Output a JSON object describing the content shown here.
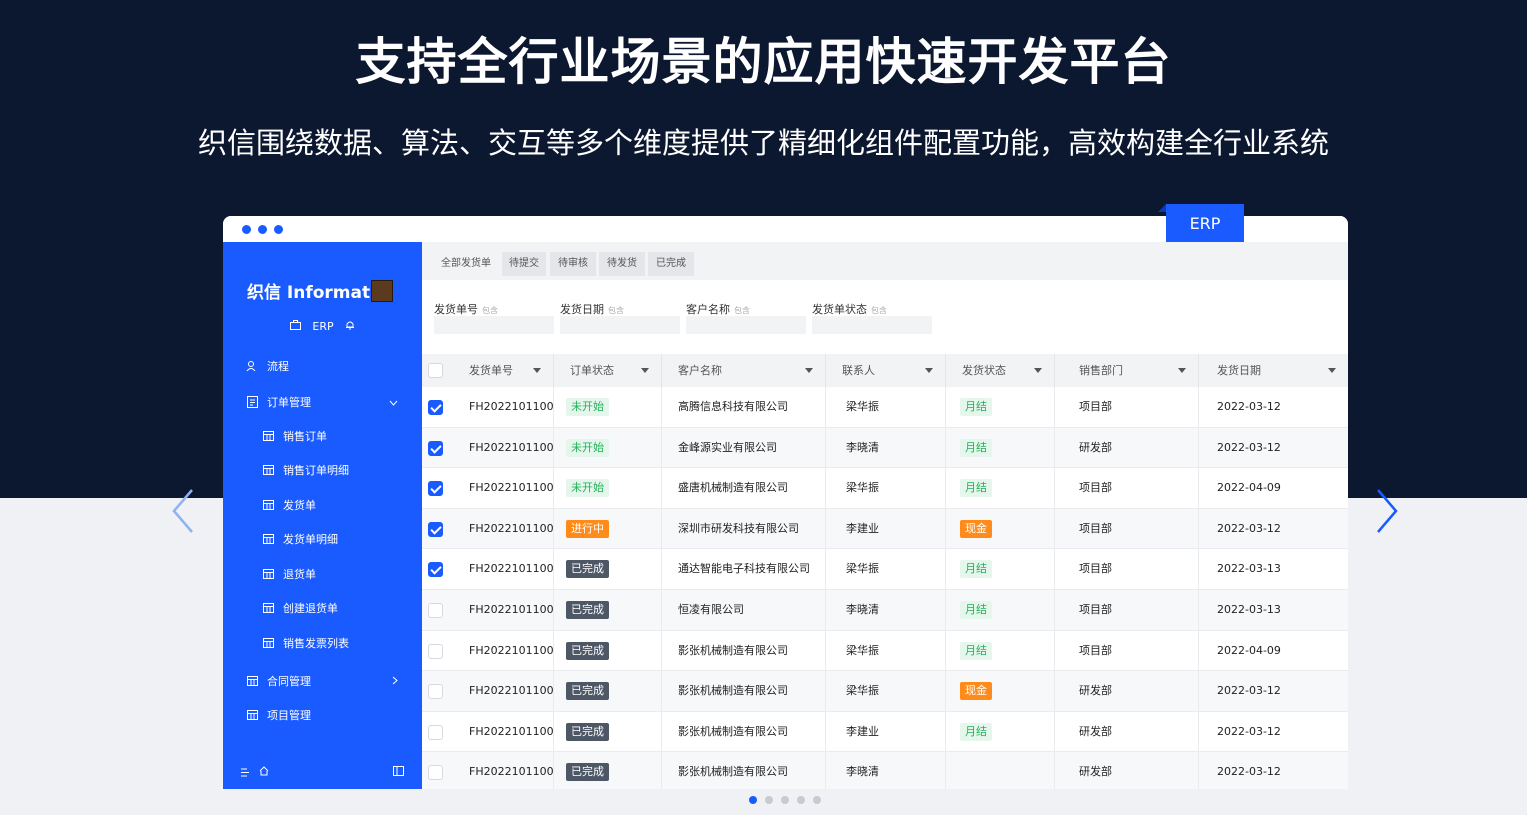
{
  "hero": {
    "title": "支持全行业场景的应用快速开发平台",
    "subtitle": "织信围绕数据、算法、交互等多个维度提供了精细化组件配置功能，高效构建全行业系统"
  },
  "corner_tag": "ERP",
  "colors": {
    "accent": "#1a5bff",
    "hero_bg": "#0c1730",
    "success": "#25b05a",
    "warning": "#ff8c1a",
    "dark_badge": "#4e5766"
  },
  "sidebar": {
    "brand": "织信 Informat",
    "app_label": "ERP",
    "items": [
      {
        "label": "流程",
        "icon": "flow-icon"
      },
      {
        "label": "订单管理",
        "icon": "document-icon",
        "expanded": true
      },
      {
        "label": "销售订单",
        "icon": "table-icon"
      },
      {
        "label": "销售订单明细",
        "icon": "table-icon"
      },
      {
        "label": "发货单",
        "icon": "table-icon"
      },
      {
        "label": "发货单明细",
        "icon": "table-icon"
      },
      {
        "label": "退货单",
        "icon": "table-icon"
      },
      {
        "label": "创建退货单",
        "icon": "table-icon"
      },
      {
        "label": "销售发票列表",
        "icon": "table-icon"
      },
      {
        "label": "合同管理",
        "icon": "table-icon",
        "expanded": false
      },
      {
        "label": "项目管理",
        "icon": "table-icon"
      }
    ]
  },
  "tabs": [
    {
      "label": "全部发货单",
      "active": true
    },
    {
      "label": "待提交"
    },
    {
      "label": "待审核"
    },
    {
      "label": "待发货"
    },
    {
      "label": "已完成"
    }
  ],
  "filters": [
    {
      "label": "发货单号",
      "tag": "包含"
    },
    {
      "label": "发货日期",
      "tag": "包含"
    },
    {
      "label": "客户名称",
      "tag": "包含"
    },
    {
      "label": "发货单状态",
      "tag": "包含"
    }
  ],
  "table": {
    "columns": [
      "发货单号",
      "订单状态",
      "客户名称",
      "联系人",
      "发货状态",
      "销售部门",
      "发货日期"
    ],
    "rows": [
      {
        "checked": true,
        "no": "FH2022101100",
        "status": "未开始",
        "status_type": "notstart",
        "customer": "高腾信息科技有限公司",
        "contact": "梁华振",
        "ship": "月结",
        "ship_type": "month",
        "dept": "项目部",
        "date": "2022-03-12"
      },
      {
        "checked": true,
        "no": "FH2022101100",
        "status": "未开始",
        "status_type": "notstart",
        "customer": "金峰源实业有限公司",
        "contact": "李晓清",
        "ship": "月结",
        "ship_type": "month",
        "dept": "研发部",
        "date": "2022-03-12"
      },
      {
        "checked": true,
        "no": "FH2022101100",
        "status": "未开始",
        "status_type": "notstart",
        "customer": "盛唐机械制造有限公司",
        "contact": "梁华振",
        "ship": "月结",
        "ship_type": "month",
        "dept": "项目部",
        "date": "2022-04-09"
      },
      {
        "checked": true,
        "no": "FH2022101100",
        "status": "进行中",
        "status_type": "progress",
        "customer": "深圳市研发科技有限公司",
        "contact": "李建业",
        "ship": "现金",
        "ship_type": "cash",
        "dept": "项目部",
        "date": "2022-03-12"
      },
      {
        "checked": true,
        "no": "FH2022101100",
        "status": "已完成",
        "status_type": "done",
        "customer": "通达智能电子科技有限公司",
        "contact": "梁华振",
        "ship": "月结",
        "ship_type": "month",
        "dept": "项目部",
        "date": "2022-03-13"
      },
      {
        "checked": false,
        "no": "FH2022101100",
        "status": "已完成",
        "status_type": "done",
        "customer": "恒凌有限公司",
        "contact": "李晓清",
        "ship": "月结",
        "ship_type": "month",
        "dept": "项目部",
        "date": "2022-03-13"
      },
      {
        "checked": false,
        "no": "FH2022101100",
        "status": "已完成",
        "status_type": "done",
        "customer": "影张机械制造有限公司",
        "contact": "梁华振",
        "ship": "月结",
        "ship_type": "month",
        "dept": "项目部",
        "date": "2022-04-09"
      },
      {
        "checked": false,
        "no": "FH2022101100",
        "status": "已完成",
        "status_type": "done",
        "customer": "影张机械制造有限公司",
        "contact": "梁华振",
        "ship": "现金",
        "ship_type": "cash",
        "dept": "研发部",
        "date": "2022-03-12"
      },
      {
        "checked": false,
        "no": "FH2022101100",
        "status": "已完成",
        "status_type": "done",
        "customer": "影张机械制造有限公司",
        "contact": "李建业",
        "ship": "月结",
        "ship_type": "month",
        "dept": "研发部",
        "date": "2022-03-12"
      },
      {
        "checked": false,
        "no": "FH2022101100",
        "status": "已完成",
        "status_type": "done",
        "customer": "影张机械制造有限公司",
        "contact": "李晓清",
        "ship": "",
        "ship_type": "none",
        "dept": "研发部",
        "date": "2022-03-12"
      }
    ]
  },
  "carousel": {
    "count": 5,
    "active": 1
  }
}
